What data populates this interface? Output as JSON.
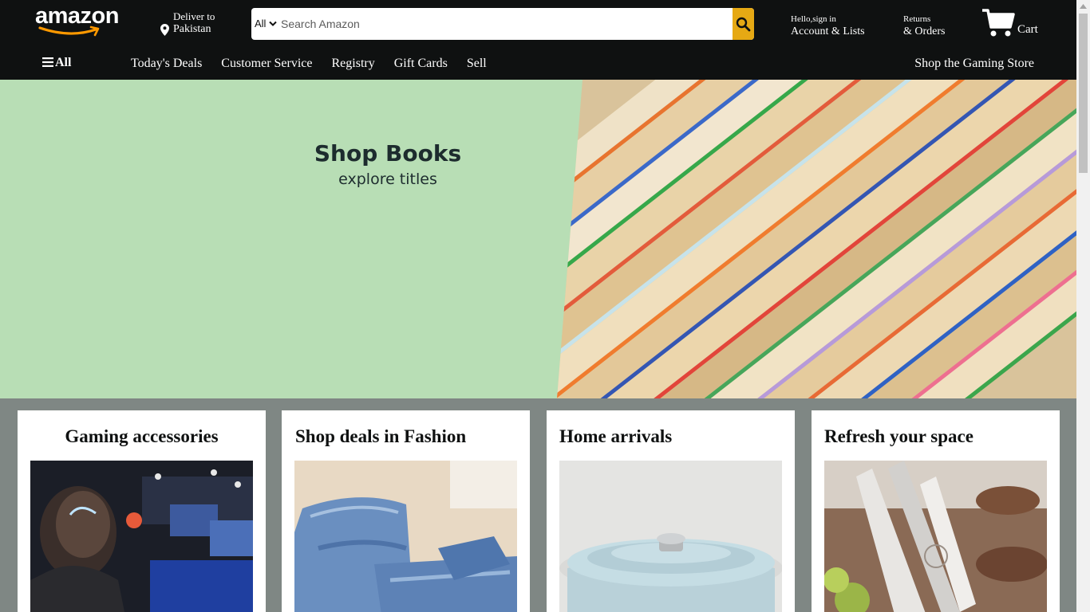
{
  "header": {
    "logo_text": "amazon",
    "deliver_label": "Deliver to",
    "deliver_location": "Pakistan",
    "search_category": "All",
    "search_placeholder": "Search Amazon",
    "account_small": "Hello,sign in",
    "account_big": "Account & Lists",
    "orders_small": "Returns",
    "orders_big": "& Orders",
    "cart_label": "Cart"
  },
  "nav": {
    "all_label": "All",
    "links": [
      "Today's Deals",
      "Customer Service",
      "Registry",
      "Gift Cards",
      "Sell"
    ],
    "promo": "Shop the Gaming Store"
  },
  "hero": {
    "title": "Shop Books",
    "subtitle": "explore titles"
  },
  "cards": [
    {
      "title": "Gaming accessories"
    },
    {
      "title": "Shop deals in Fashion"
    },
    {
      "title": "Home arrivals"
    },
    {
      "title": "Refresh your space"
    }
  ],
  "colors": {
    "header_bg": "#0f1111",
    "search_button": "#e6a914",
    "hero_bg": "#b8deb5",
    "page_bg": "#7f8784"
  }
}
